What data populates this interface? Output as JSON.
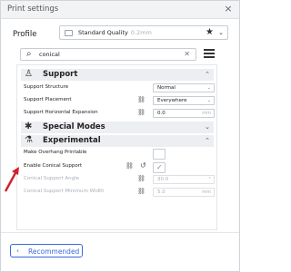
{
  "window": {
    "title": "Print settings",
    "close_glyph": "×"
  },
  "profile": {
    "label": "Profile",
    "value": "Standard Quality",
    "subvalue": "0.2mm",
    "star_icon": "★",
    "chevron_icon": "⌄"
  },
  "search": {
    "value": "conical",
    "clear_icon": "✕"
  },
  "categories": {
    "support": {
      "label": "Support",
      "chevron": "⌃"
    },
    "special_modes": {
      "label": "Special Modes",
      "chevron": "⌄"
    },
    "experimental": {
      "label": "Experimental",
      "chevron": "⌃"
    }
  },
  "settings": {
    "support_structure": {
      "label": "Support Structure",
      "value": "Normal",
      "chevron": "⌄"
    },
    "support_placement": {
      "label": "Support Placement",
      "value": "Everywhere",
      "chevron": "⌄"
    },
    "support_horizontal_expansion": {
      "label": "Support Horizontal Expansion",
      "value": "0.0",
      "unit": "mm"
    },
    "make_overhang_printable": {
      "label": "Make Overhang Printable",
      "checked": false
    },
    "enable_conical_support": {
      "label": "Enable Conical Support",
      "checked": true,
      "check_glyph": "✓"
    },
    "conical_support_angle": {
      "label": "Conical Support Angle",
      "value": "30.0",
      "unit": "°"
    },
    "conical_support_minimum_width": {
      "label": "Conical Support Minimum Width",
      "value": "5.0",
      "unit": "mm"
    }
  },
  "footer": {
    "recommended_label": "Recommended",
    "chevron": "‹"
  },
  "colors": {
    "accent": "#3a6bd8",
    "annotation": "#d0202a",
    "header_bg": "#eceef1"
  }
}
